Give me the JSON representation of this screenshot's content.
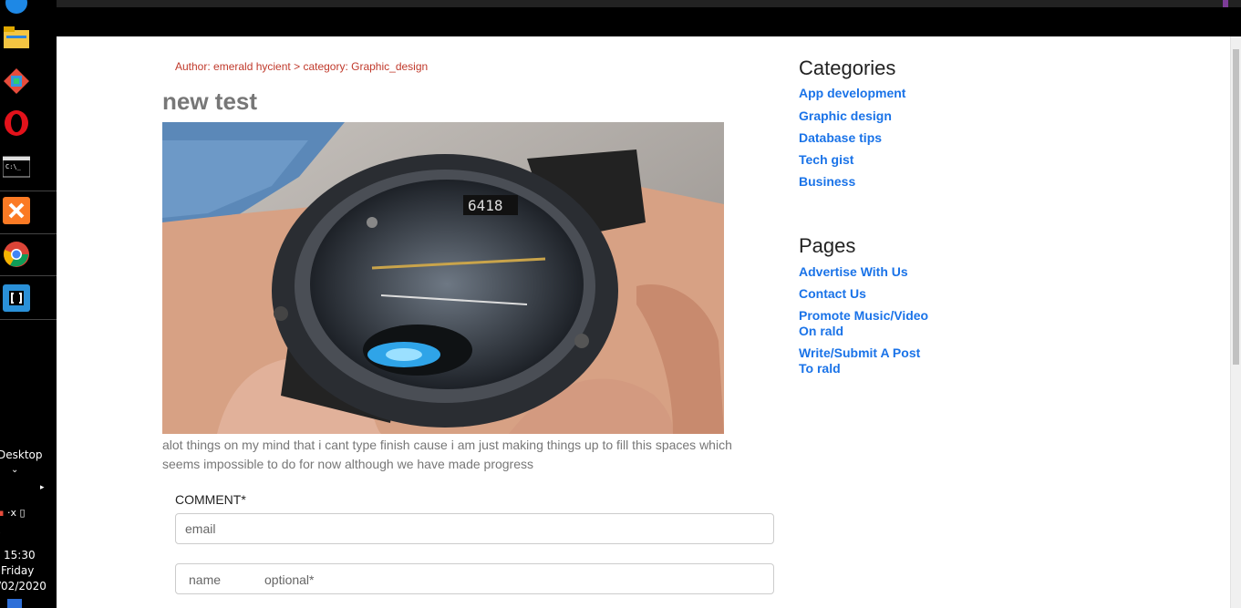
{
  "taskbar": {
    "desktop_label": "Desktop",
    "time": "15:30",
    "day": "Friday",
    "date": "/02/2020"
  },
  "breadcrumb": {
    "author": "Author: emerald hycient",
    "separator": ">",
    "category": "category: Graphic_design"
  },
  "post": {
    "title": "new test",
    "body": "alot things on my mind that i cant type finish cause i am just making things up to fill this spaces which seems impossible to do for now although we have made progress"
  },
  "comment": {
    "label": "COMMENT*",
    "email_placeholder": "email",
    "name_label": "name",
    "optional_label": "optional*"
  },
  "sidebar": {
    "categories_title": "Categories",
    "categories": [
      "App development",
      "Graphic design",
      "Database tips",
      "Tech gist",
      "Business"
    ],
    "pages_title": "Pages",
    "pages": [
      "Advertise With Us",
      "Contact Us",
      "Promote Music/Video On rald",
      "Write/Submit A Post To rald"
    ]
  },
  "colors": {
    "link": "#1a73e8",
    "breadcrumb": "#c0392b",
    "title": "#777777"
  }
}
